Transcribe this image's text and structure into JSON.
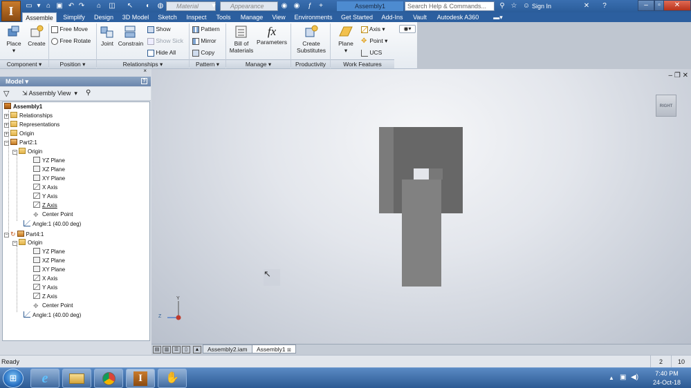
{
  "app": {
    "logo_letter": "I",
    "document_title": "Assembly1",
    "search_placeholder": "Search Help & Commands...",
    "sign_in": "Sign In",
    "material_placeholder": "Material",
    "appearance_placeholder": "Appearance"
  },
  "ribbon_tabs": [
    "Assemble",
    "Simplify",
    "Design",
    "3D Model",
    "Sketch",
    "Inspect",
    "Tools",
    "Manage",
    "View",
    "Environments",
    "Get Started",
    "Add-Ins",
    "Vault",
    "Autodesk A360"
  ],
  "ribbon": {
    "component": {
      "place": "Place",
      "create": "Create",
      "group": "Component"
    },
    "position": {
      "free_move": "Free Move",
      "free_rotate": "Free Rotate",
      "group": "Position"
    },
    "relationships": {
      "joint": "Joint",
      "constrain": "Constrain",
      "show": "Show",
      "show_sick": "Show Sick",
      "hide_all": "Hide All",
      "group": "Relationships"
    },
    "pattern": {
      "pattern": "Pattern",
      "mirror": "Mirror",
      "copy": "Copy",
      "group": "Pattern"
    },
    "manage": {
      "bom": "Bill of\nMaterials",
      "parameters": "Parameters",
      "group": "Manage"
    },
    "productivity": {
      "create_substitutes": "Create\nSubstitutes",
      "group": "Productivity"
    },
    "work_features": {
      "plane": "Plane",
      "axis": "Axis",
      "point": "Point",
      "ucs": "UCS",
      "group": "Work Features"
    }
  },
  "browser": {
    "title": "Model",
    "view": "Assembly View",
    "tree": [
      {
        "label": "Assembly1",
        "icon": "assembly-icon",
        "bold": true
      },
      {
        "label": "Relationships",
        "icon": "folder-icon"
      },
      {
        "label": "Representations",
        "icon": "folder-icon"
      },
      {
        "label": "Origin",
        "icon": "folder-icon"
      },
      {
        "label": "Part2:1",
        "icon": "part-icon"
      },
      {
        "label": "Origin",
        "icon": "folder-icon"
      },
      {
        "label": "YZ Plane",
        "icon": "plane-icon"
      },
      {
        "label": "XZ Plane",
        "icon": "plane-icon"
      },
      {
        "label": "XY Plane",
        "icon": "plane-icon"
      },
      {
        "label": "X Axis",
        "icon": "axis-icon"
      },
      {
        "label": "Y Axis",
        "icon": "axis-icon"
      },
      {
        "label": "Z Axis",
        "icon": "axis-icon"
      },
      {
        "label": "Center Point",
        "icon": "point-icon"
      },
      {
        "label": "Angle:1 (40.00 deg)",
        "icon": "constraint-icon"
      },
      {
        "label": "Part4:1",
        "icon": "part-icon"
      },
      {
        "label": "Origin",
        "icon": "folder-icon"
      },
      {
        "label": "YZ Plane",
        "icon": "plane-icon"
      },
      {
        "label": "XZ Plane",
        "icon": "plane-icon"
      },
      {
        "label": "XY Plane",
        "icon": "plane-icon"
      },
      {
        "label": "X Axis",
        "icon": "axis-icon"
      },
      {
        "label": "Y Axis",
        "icon": "axis-icon"
      },
      {
        "label": "Z Axis",
        "icon": "axis-icon"
      },
      {
        "label": "Center Point",
        "icon": "point-icon"
      },
      {
        "label": "Angle:1 (40.00 deg)",
        "icon": "constraint-icon"
      }
    ]
  },
  "viewport": {
    "viewcube_label": "RIGHT",
    "triad_y": "Y",
    "triad_z": "Z",
    "colors": {
      "part_dark": "#676767",
      "part_mid": "#7b7b7b",
      "part_front": "#818181"
    }
  },
  "doc_tabs": [
    "Assembly2.iam",
    "Assembly1"
  ],
  "status": {
    "text": "Ready",
    "count1": "2",
    "count2": "10"
  },
  "clock": {
    "time": "7:40 PM",
    "date": "24-Oct-18"
  }
}
